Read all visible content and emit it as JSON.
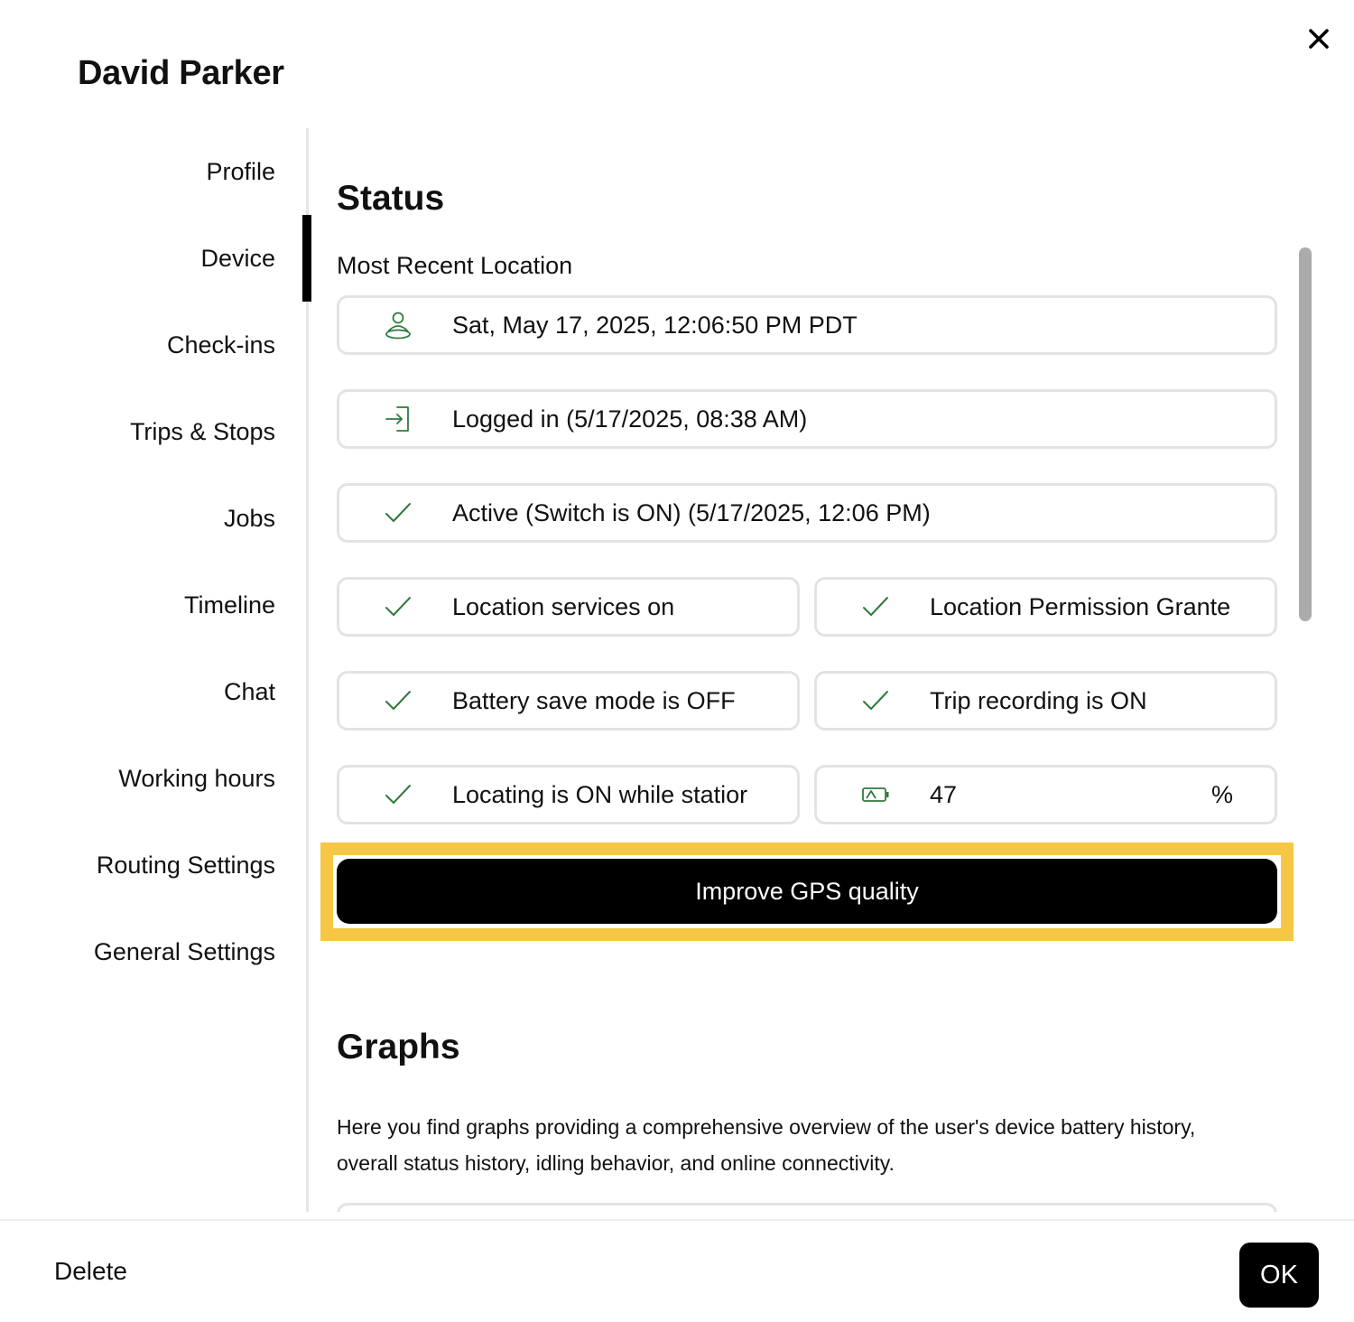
{
  "dialog": {
    "title": "David Parker",
    "close_icon": "close-icon"
  },
  "sidebar": {
    "items": [
      {
        "label": "Profile",
        "active": false
      },
      {
        "label": "Device",
        "active": true
      },
      {
        "label": "Check-ins",
        "active": false
      },
      {
        "label": "Trips & Stops",
        "active": false
      },
      {
        "label": "Jobs",
        "active": false
      },
      {
        "label": "Timeline",
        "active": false
      },
      {
        "label": "Chat",
        "active": false
      },
      {
        "label": "Working hours",
        "active": false
      },
      {
        "label": "Routing Settings",
        "active": false
      },
      {
        "label": "General Settings",
        "active": false
      }
    ]
  },
  "status": {
    "title": "Status",
    "location_label": "Most Recent Location",
    "cards": {
      "last_location": {
        "icon": "person-location-icon",
        "text": "Sat, May 17, 2025, 12:06:50 PM PDT"
      },
      "logged_in": {
        "icon": "login-icon",
        "text": "Logged in (5/17/2025, 08:38 AM)"
      },
      "active": {
        "icon": "check-icon",
        "text": "Active (Switch is ON) (5/17/2025, 12:06 PM)"
      },
      "location_services": {
        "icon": "check-icon",
        "text": "Location services on"
      },
      "location_permission": {
        "icon": "check-icon",
        "text": "Location Permission Grante"
      },
      "battery_save": {
        "icon": "check-icon",
        "text": "Battery save mode is OFF"
      },
      "trip_recording": {
        "icon": "check-icon",
        "text": "Trip recording is ON"
      },
      "locating_stationary": {
        "icon": "check-icon",
        "text": "Locating is ON while statior"
      },
      "battery_level": {
        "icon": "battery-icon",
        "value": "47",
        "unit": "%"
      }
    },
    "improve_button": "Improve GPS quality"
  },
  "graphs": {
    "title": "Graphs",
    "description": "Here you find graphs providing a comprehensive overview of the user's device battery history, overall status history, idling behavior, and online connectivity."
  },
  "footer": {
    "delete_label": "Delete",
    "ok_label": "OK"
  },
  "colors": {
    "icon_green": "#2f7a3d",
    "highlight": "#f5c744",
    "button_bg": "#000000",
    "card_border": "#e3e3e3"
  }
}
